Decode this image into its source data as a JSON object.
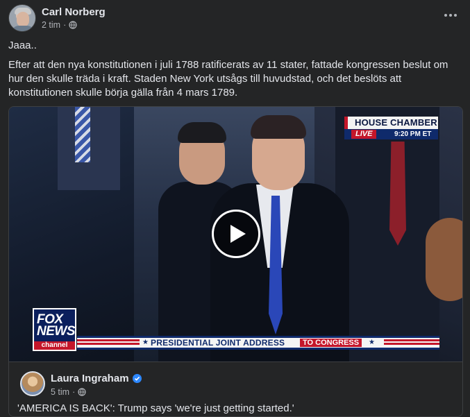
{
  "post": {
    "author": "Carl Norberg",
    "time": "2 tim",
    "separator": "·",
    "privacy_icon": "globe-icon",
    "more_icon": "more-options-icon",
    "text_short": "Jaaa..",
    "text_long": "Efter att den nya konstitutionen i juli 1788 ratificerats av 11 stater, fattade kongressen beslut om hur den skulle träda i kraft. Staden New York utsågs till huvudstad, och det beslöts att konstitutionen skulle börja gälla från 4 mars 1789."
  },
  "video": {
    "play_icon": "play-icon",
    "overlay": {
      "chamber": "HOUSE CHAMBER",
      "live": "LIVE",
      "time": "9:20 PM ET",
      "network_line1": "FOX",
      "network_line2": "NEWS",
      "network_channel": "channel",
      "banner_main": "PRESIDENTIAL JOINT ADDRESS",
      "banner_sub": "TO CONGRESS",
      "star": "★"
    }
  },
  "shared": {
    "author": "Laura Ingraham",
    "verified_icon": "verified-badge-icon",
    "time": "5 tim",
    "separator": "·",
    "privacy_icon": "globe-icon",
    "text": "'AMERICA IS BACK': Trump says 'we're just getting started.'"
  },
  "colors": {
    "background": "#242526",
    "text_primary": "#e4e6eb",
    "text_secondary": "#b0b3b8",
    "verified_blue": "#2d88ff",
    "fox_blue": "#0b1f5c",
    "fox_red": "#c4162a"
  }
}
